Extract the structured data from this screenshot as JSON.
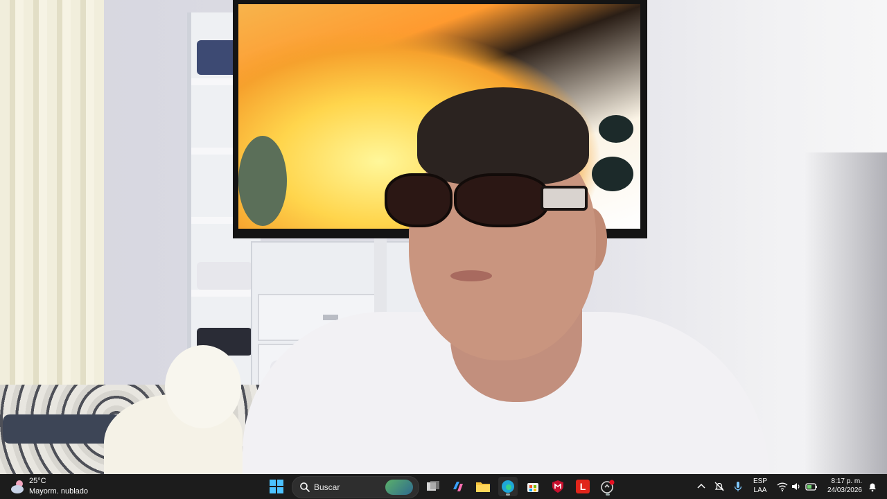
{
  "taskbar": {
    "weather": {
      "temperature": "25°C",
      "condition": "Mayorm. nublado",
      "icon": "partly-cloudy-icon"
    },
    "search": {
      "placeholder": "Buscar"
    },
    "apps": [
      {
        "name": "start-button",
        "icon": "windows-logo-icon"
      },
      {
        "name": "task-view-button",
        "icon": "task-view-icon"
      },
      {
        "name": "copilot-button",
        "icon": "copilot-icon"
      },
      {
        "name": "file-explorer-button",
        "icon": "folder-icon"
      },
      {
        "name": "edge-button",
        "icon": "edge-icon"
      },
      {
        "name": "store-button",
        "icon": "store-icon"
      },
      {
        "name": "mcafee-button",
        "icon": "mcafee-icon"
      },
      {
        "name": "l-app-button",
        "icon": "l-app-icon",
        "label": "L"
      },
      {
        "name": "recording-app-button",
        "icon": "camera-record-icon"
      }
    ],
    "tray": {
      "language_top": "ESP",
      "language_bottom": "LAA",
      "time": "8:17 p. m.",
      "date": "24/03/2026"
    }
  }
}
